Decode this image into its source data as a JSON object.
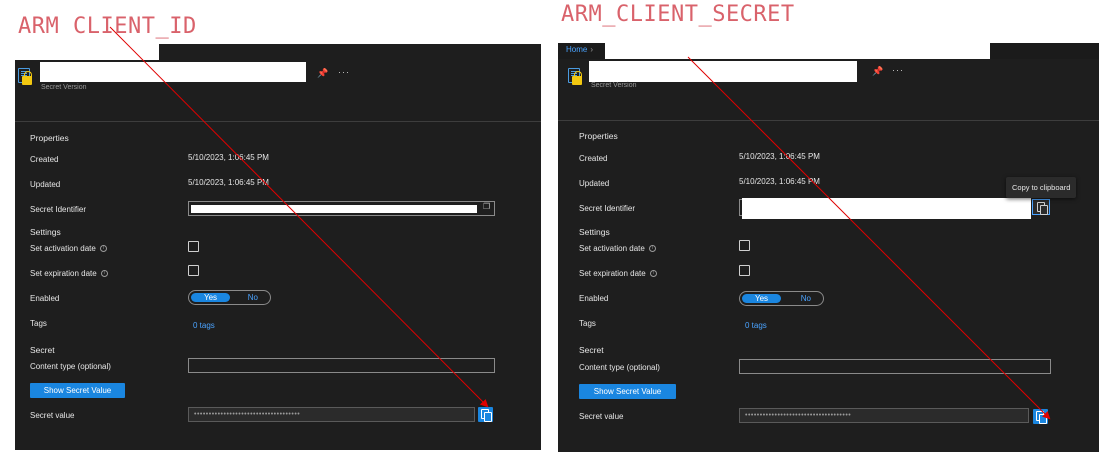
{
  "captions": {
    "left": "ARM CLIENT_ID",
    "right": "ARM_CLIENT_SECRET"
  },
  "colors": {
    "panel_bg": "#1e1e1e",
    "accent": "#1a86e0",
    "link": "#4aa3ff",
    "annotation_arrow": "#e00000",
    "caption": "#d9626b"
  },
  "icons": {
    "resource": "key-vault-secret-icon",
    "pin": "pin-icon",
    "more": "more-icon",
    "info": "info-icon",
    "copy": "copy-icon"
  },
  "breadcrumb": {
    "home": "Home",
    "separator": "›"
  },
  "panels": [
    {
      "subtitle": "Secret Version",
      "more": "···",
      "properties_heading": "Properties",
      "created_label": "Created",
      "created_value": "5/10/2023, 1:06:45 PM",
      "updated_label": "Updated",
      "updated_value": "5/10/2023, 1:06:45 PM",
      "secret_identifier_label": "Secret Identifier",
      "settings_heading": "Settings",
      "activation_label": "Set activation date",
      "expiration_label": "Set expiration date",
      "enabled_label": "Enabled",
      "yes": "Yes",
      "no": "No",
      "tags_label": "Tags",
      "tags_value": "0 tags",
      "secret_heading": "Secret",
      "content_type_label": "Content type (optional)",
      "show_secret_button": "Show Secret Value",
      "secret_value_label": "Secret value",
      "secret_value_masked": "••••••••••••••••••••••••••••••••••••"
    },
    {
      "subtitle": "Secret Version",
      "more": "···",
      "properties_heading": "Properties",
      "created_label": "Created",
      "created_value": "5/10/2023, 1:06:45 PM",
      "updated_label": "Updated",
      "updated_value": "5/10/2023, 1:06:45 PM",
      "secret_identifier_label": "Secret Identifier",
      "settings_heading": "Settings",
      "activation_label": "Set activation date",
      "expiration_label": "Set expiration date",
      "enabled_label": "Enabled",
      "yes": "Yes",
      "no": "No",
      "tags_label": "Tags",
      "tags_value": "0 tags",
      "secret_heading": "Secret",
      "content_type_label": "Content type (optional)",
      "show_secret_button": "Show Secret Value",
      "secret_value_label": "Secret value",
      "secret_value_masked": "••••••••••••••••••••••••••••••••••••",
      "tooltip": "Copy to clipboard"
    }
  ]
}
